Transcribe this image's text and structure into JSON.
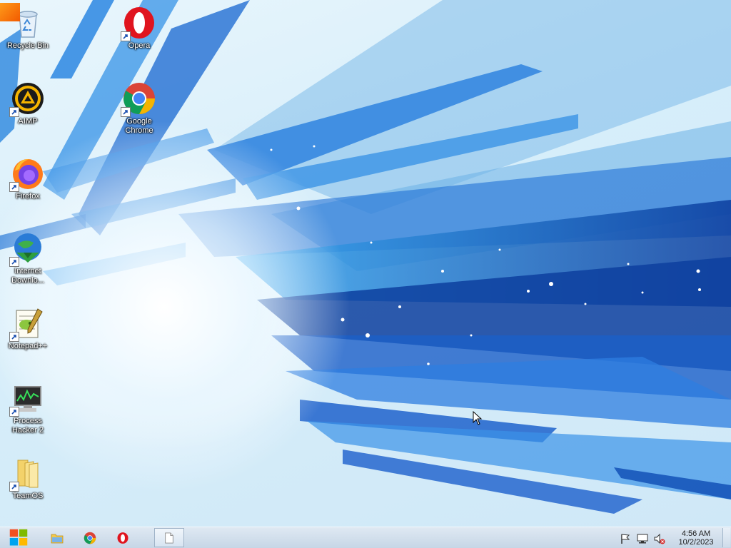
{
  "desktop": {
    "icons": [
      {
        "name": "recycle-bin",
        "label": "Recycle Bin",
        "icon": "recycle-bin-icon",
        "shortcut": false
      },
      {
        "name": "opera",
        "label": "Opera",
        "icon": "opera-icon",
        "shortcut": true
      },
      {
        "name": "aimp",
        "label": "AIMP",
        "icon": "aimp-icon",
        "shortcut": true
      },
      {
        "name": "google-chrome",
        "label": "Google\nChrome",
        "icon": "chrome-icon",
        "shortcut": true
      },
      {
        "name": "firefox",
        "label": "Firefox",
        "icon": "firefox-icon",
        "shortcut": true
      },
      {
        "name": "internet-download-manager",
        "label": "Internet\nDownlo...",
        "icon": "idm-icon",
        "shortcut": true
      },
      {
        "name": "notepad-plus-plus",
        "label": "Notepad++",
        "icon": "notepad-plus-plus-icon",
        "shortcut": true
      },
      {
        "name": "process-hacker",
        "label": "Process\nHacker 2",
        "icon": "process-hacker-icon",
        "shortcut": true
      },
      {
        "name": "teamos",
        "label": "TeamOS",
        "icon": "folder-icon",
        "shortcut": true
      }
    ]
  },
  "taskbar": {
    "start_icon": "windows-logo-icon",
    "pinned": [
      {
        "name": "file-explorer",
        "icon": "folder-icon"
      },
      {
        "name": "chrome",
        "icon": "chrome-icon"
      },
      {
        "name": "opera",
        "icon": "opera-icon"
      }
    ],
    "open_window_icon": "blank-document-icon",
    "tray": [
      "action-center-flag-icon",
      "network-icon",
      "volume-muted-icon"
    ],
    "clock": {
      "time": "4:56 AM",
      "date": "10/2/2023"
    }
  },
  "colors": {
    "wallpaper_blue": "#1a73d9",
    "wallpaper_dark": "#0a2f8c",
    "taskbar": "#d2dfec",
    "text": "#ffffff"
  }
}
